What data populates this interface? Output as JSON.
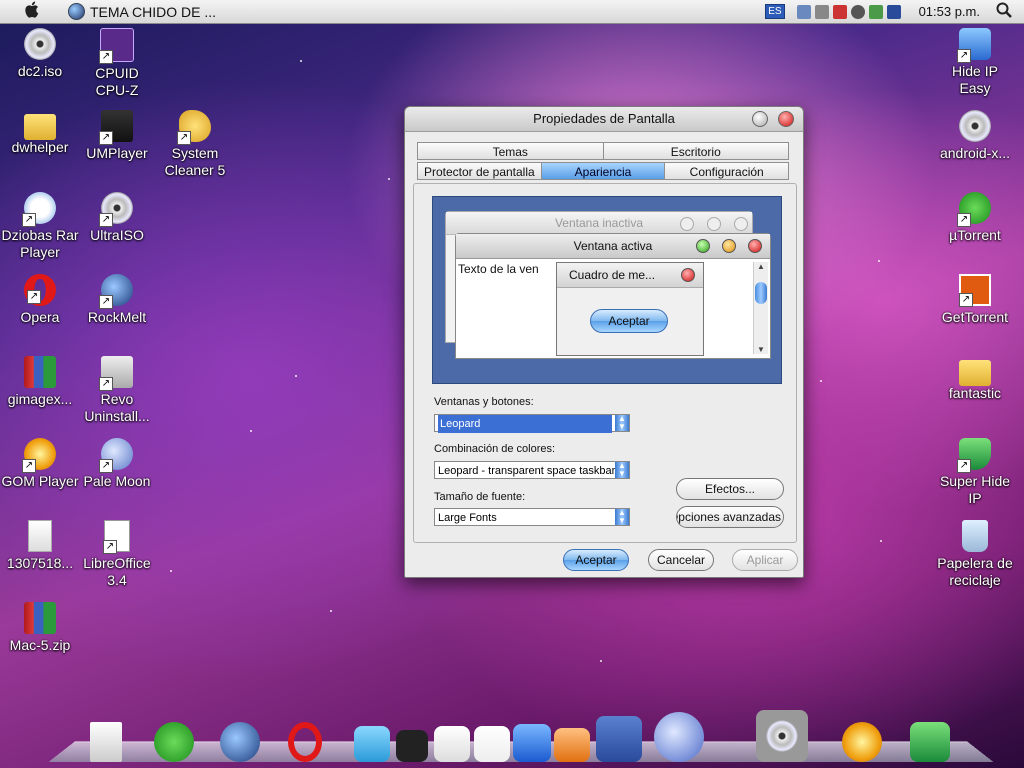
{
  "menubar": {
    "apple_icon": "",
    "app_title": "TEMA CHIDO DE ...",
    "lang": "ES",
    "clock": "01:53 p.m.",
    "search_icon": "magnifier"
  },
  "desktop_icons": {
    "dc2": "dc2.iso",
    "cpuz": "CPUID CPU-Z",
    "dwhelper": "dwhelper",
    "umplayer": "UMPlayer",
    "syscleaner": "System Cleaner 5",
    "dziobas": "Dziobas Rar Player",
    "ultraiso": "UltraISO",
    "opera": "Opera",
    "rockmelt": "RockMelt",
    "gimagex": "gimagex...",
    "revo": "Revo Uninstall...",
    "gom": "GOM Player",
    "palemoon": "Pale Moon",
    "file1307": "1307518...",
    "libreoffice": "LibreOffice 3.4",
    "mac5": "Mac-5.zip",
    "hideip": "Hide IP Easy",
    "androidx": "android-x...",
    "utorrent": "µTorrent",
    "gettorrent": "GetTorrent",
    "fantastic": "fantastic",
    "superhide": "Super Hide IP",
    "recycle": "Papelera de reciclaje"
  },
  "dialog": {
    "title": "Propiedades de Pantalla",
    "tabs_top": [
      "Temas",
      "Escritorio"
    ],
    "tabs_bottom": [
      "Protector de pantalla",
      "Apariencia",
      "Configuración"
    ],
    "active_tab": "Apariencia",
    "preview": {
      "inactive_title": "Ventana inactiva",
      "active_title": "Ventana activa",
      "window_text": "Texto de la ven",
      "msgbox_title": "Cuadro de me...",
      "msgbox_button": "Aceptar"
    },
    "windows_buttons_label": "Ventanas y botones:",
    "windows_buttons_value": "Leopard",
    "color_scheme_label": "Combinación de colores:",
    "color_scheme_value": "Leopard - transparent space taskbar",
    "font_size_label": "Tamaño de fuente:",
    "font_size_value": "Large Fonts",
    "effects_button": "Efectos...",
    "advanced_button": "Opciones avanzadas",
    "ok_button": "Aceptar",
    "cancel_button": "Cancelar",
    "apply_button": "Aplicar"
  }
}
